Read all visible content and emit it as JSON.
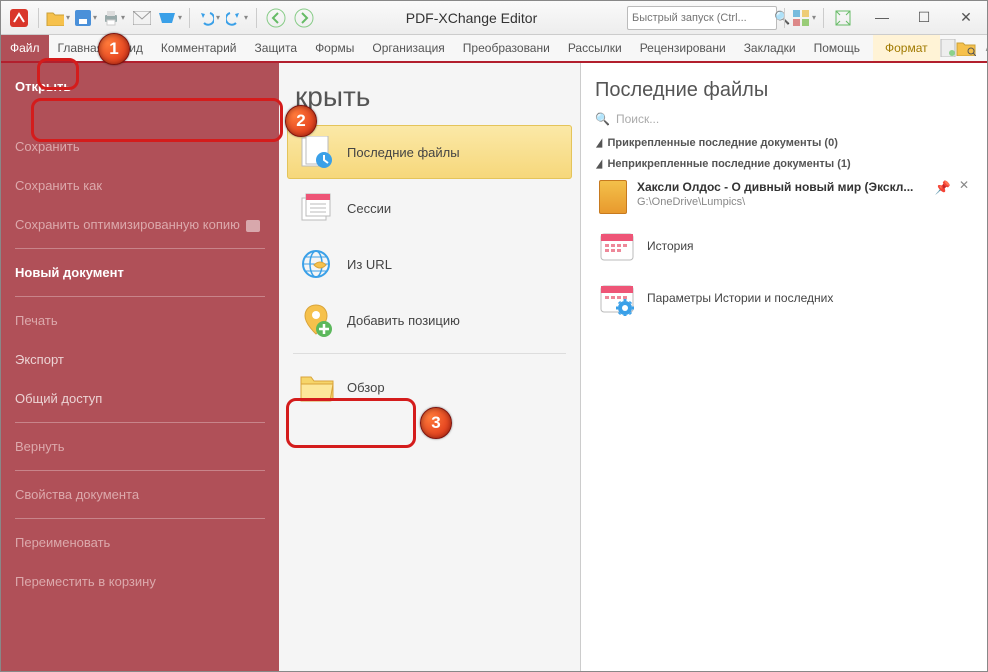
{
  "app_title": "PDF-XChange Editor",
  "quick_launch_placeholder": "Быстрый запуск (Ctrl...",
  "ribbon": {
    "tabs": [
      "Файл",
      "Главная",
      "Вид",
      "Комментарий",
      "Защита",
      "Формы",
      "Организация",
      "Преобразовани",
      "Рассылки",
      "Рецензировани",
      "Закладки",
      "Помощь"
    ],
    "format_tab": "Формат"
  },
  "sidebar": {
    "items": [
      {
        "label": "Открыть",
        "kind": "active"
      },
      {
        "kind": "spacer"
      },
      {
        "label": "Сохранить",
        "kind": "disabled"
      },
      {
        "label": "Сохранить как",
        "kind": "disabled"
      },
      {
        "label": "Сохранить оптимизированную копию",
        "kind": "disabled cart"
      },
      {
        "kind": "divider"
      },
      {
        "label": "Новый документ",
        "kind": "bold"
      },
      {
        "kind": "divider"
      },
      {
        "label": "Печать",
        "kind": "disabled"
      },
      {
        "label": "Экспорт",
        "kind": "normal"
      },
      {
        "label": "Общий доступ",
        "kind": "normal"
      },
      {
        "kind": "divider"
      },
      {
        "label": "Вернуть",
        "kind": "disabled"
      },
      {
        "kind": "divider"
      },
      {
        "label": "Свойства документа",
        "kind": "disabled"
      },
      {
        "kind": "divider"
      },
      {
        "label": "Переименовать",
        "kind": "disabled"
      },
      {
        "label": "Переместить в корзину",
        "kind": "disabled"
      }
    ]
  },
  "mid": {
    "title": "крыть",
    "items": [
      {
        "label": "Последние файлы",
        "icon": "recent",
        "selected": true
      },
      {
        "label": "Сессии",
        "icon": "sessions"
      },
      {
        "label": "Из URL",
        "icon": "url"
      },
      {
        "label": "Добавить позицию",
        "icon": "add-place"
      },
      {
        "divider": true
      },
      {
        "label": "Обзор",
        "icon": "browse"
      }
    ]
  },
  "right": {
    "title": "Последние файлы",
    "search_placeholder": "Поиск...",
    "group_pinned": "Прикрепленные последние документы (0)",
    "group_unpinned": "Неприкрепленные последние документы (1)",
    "recent_title": "Хаксли Олдос - О дивный новый мир (Экскл...",
    "recent_path": "G:\\OneDrive\\Lumpics\\",
    "history": "История",
    "history_params": "Параметры Истории и последних"
  },
  "callouts": {
    "1": "1",
    "2": "2",
    "3": "3"
  }
}
